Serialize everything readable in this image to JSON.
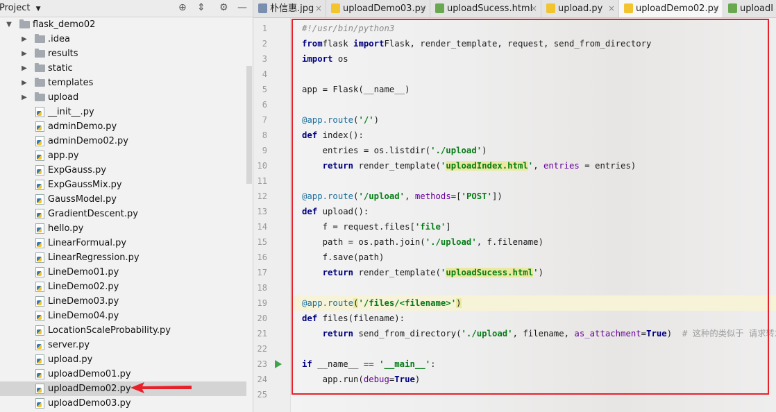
{
  "project_panel": {
    "title": "Project",
    "tree": [
      {
        "label": "flask_demo02",
        "type": "folder",
        "depth": 0,
        "expanded": true
      },
      {
        "label": ".idea",
        "type": "folder",
        "depth": 1
      },
      {
        "label": "results",
        "type": "folder",
        "depth": 1
      },
      {
        "label": "static",
        "type": "folder",
        "depth": 1
      },
      {
        "label": "templates",
        "type": "folder",
        "depth": 1
      },
      {
        "label": "upload",
        "type": "folder",
        "depth": 1
      },
      {
        "label": "__init__.py",
        "type": "py",
        "depth": 1
      },
      {
        "label": "adminDemo.py",
        "type": "py",
        "depth": 1
      },
      {
        "label": "adminDemo02.py",
        "type": "py",
        "depth": 1
      },
      {
        "label": "app.py",
        "type": "py",
        "depth": 1
      },
      {
        "label": "ExpGauss.py",
        "type": "py",
        "depth": 1
      },
      {
        "label": "ExpGaussMix.py",
        "type": "py",
        "depth": 1
      },
      {
        "label": "GaussModel.py",
        "type": "py",
        "depth": 1
      },
      {
        "label": "GradientDescent.py",
        "type": "py",
        "depth": 1
      },
      {
        "label": "hello.py",
        "type": "py",
        "depth": 1
      },
      {
        "label": "LinearFormual.py",
        "type": "py",
        "depth": 1
      },
      {
        "label": "LinearRegression.py",
        "type": "py",
        "depth": 1
      },
      {
        "label": "LineDemo01.py",
        "type": "py",
        "depth": 1
      },
      {
        "label": "LineDemo02.py",
        "type": "py",
        "depth": 1
      },
      {
        "label": "LineDemo03.py",
        "type": "py",
        "depth": 1
      },
      {
        "label": "LineDemo04.py",
        "type": "py",
        "depth": 1
      },
      {
        "label": "LocationScaleProbability.py",
        "type": "py",
        "depth": 1
      },
      {
        "label": "server.py",
        "type": "py",
        "depth": 1
      },
      {
        "label": "upload.py",
        "type": "py",
        "depth": 1
      },
      {
        "label": "uploadDemo01.py",
        "type": "py",
        "depth": 1
      },
      {
        "label": "uploadDemo02.py",
        "type": "py",
        "depth": 1,
        "selected": true
      },
      {
        "label": "uploadDemo03.py",
        "type": "py",
        "depth": 1
      }
    ]
  },
  "tabs": [
    {
      "label": "朴信惠.jpg",
      "icon": "image-file-icon",
      "color": "#7a8fb0"
    },
    {
      "label": "uploadDemo03.py",
      "icon": "python-file-icon",
      "color": "#f2c530"
    },
    {
      "label": "uploadSucess.html",
      "icon": "html-file-icon",
      "color": "#6aa84f"
    },
    {
      "label": "upload.py",
      "icon": "python-file-icon",
      "color": "#f2c530"
    },
    {
      "label": "uploadDemo02.py",
      "icon": "python-file-icon",
      "color": "#f2c530",
      "active": true
    },
    {
      "label": "uploadI",
      "icon": "html-file-icon",
      "color": "#6aa84f"
    }
  ],
  "editor": {
    "current_line": 19,
    "line_count": 25,
    "run_line": 23,
    "lines": [
      [
        [
          "com",
          "#!/usr/bin/python3"
        ]
      ],
      [
        [
          "kw",
          "from"
        ],
        [
          "",
          "flask "
        ],
        [
          "kw",
          "import"
        ],
        [
          "",
          "Flask, render_template, request, send_from_directory"
        ]
      ],
      [
        [
          "kw",
          "import"
        ],
        [
          "",
          " os"
        ]
      ],
      [],
      [
        [
          "",
          "app = Flask(__name__)"
        ]
      ],
      [],
      [
        [
          "dec",
          "@app.route"
        ],
        [
          "",
          "("
        ],
        [
          "str",
          "'/'"
        ],
        [
          "",
          ")"
        ]
      ],
      [
        [
          "kw",
          "def"
        ],
        [
          "",
          " index():"
        ]
      ],
      [
        [
          "",
          "    entries = os.listdir("
        ],
        [
          "str",
          "'./upload'"
        ],
        [
          "",
          ")"
        ]
      ],
      [
        [
          "",
          "    "
        ],
        [
          "kw",
          "return"
        ],
        [
          "",
          " render_template("
        ],
        [
          "str",
          "'"
        ],
        [
          "strhl",
          "uploadIndex.html"
        ],
        [
          "str",
          "'"
        ],
        [
          "",
          ", "
        ],
        [
          "par",
          "entries"
        ],
        [
          "",
          " = entries)"
        ]
      ],
      [],
      [
        [
          "dec",
          "@app.route"
        ],
        [
          "",
          "("
        ],
        [
          "str",
          "'/upload'"
        ],
        [
          "",
          ", "
        ],
        [
          "par",
          "methods"
        ],
        [
          "",
          "=["
        ],
        [
          "str",
          "'POST'"
        ],
        [
          "",
          "])"
        ]
      ],
      [
        [
          "kw",
          "def"
        ],
        [
          "",
          " upload():"
        ]
      ],
      [
        [
          "",
          "    f = request.files["
        ],
        [
          "str",
          "'file'"
        ],
        [
          "",
          "]"
        ]
      ],
      [
        [
          "",
          "    path = os.path.join("
        ],
        [
          "str",
          "'./upload'"
        ],
        [
          "",
          ", f.filename)"
        ]
      ],
      [
        [
          "",
          "    f.save(path)"
        ]
      ],
      [
        [
          "",
          "    "
        ],
        [
          "kw",
          "return"
        ],
        [
          "",
          " render_template("
        ],
        [
          "str",
          "'"
        ],
        [
          "strhl",
          "uploadSucess.html"
        ],
        [
          "str",
          "'"
        ],
        [
          "",
          ")"
        ]
      ],
      [],
      [
        [
          "dec",
          "@app.route"
        ],
        [
          "hl",
          "("
        ],
        [
          "str",
          "'/files/<filename>'"
        ],
        [
          "hl",
          ")"
        ]
      ],
      [
        [
          "kw",
          "def"
        ],
        [
          "",
          " files(filename):"
        ]
      ],
      [
        [
          "",
          "    "
        ],
        [
          "kw",
          "return"
        ],
        [
          "",
          " send_from_directory("
        ],
        [
          "str",
          "'./upload'"
        ],
        [
          "",
          ", filename, "
        ],
        [
          "par",
          "as_attachment"
        ],
        [
          "",
          "="
        ],
        [
          "kw",
          "True"
        ],
        [
          "",
          ")  "
        ],
        [
          "cn",
          "# 这种的类似于 请求转发"
        ]
      ],
      [],
      [
        [
          "kw",
          "if"
        ],
        [
          "",
          " __name__ == "
        ],
        [
          "str",
          "'__main__'"
        ],
        [
          "",
          ":"
        ]
      ],
      [
        [
          "",
          "    app.run("
        ],
        [
          "par",
          "debug"
        ],
        [
          "",
          "="
        ],
        [
          "kw",
          "True"
        ],
        [
          "",
          ")"
        ]
      ],
      []
    ]
  }
}
